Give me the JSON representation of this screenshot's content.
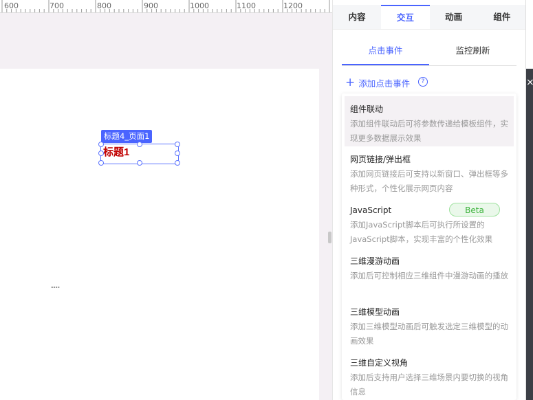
{
  "ruler": {
    "labels": [
      "600",
      "700",
      "800",
      "900",
      "1000",
      "1100",
      "1200"
    ]
  },
  "canvas": {
    "component_tag": "标题4_页面1",
    "component_text": "标题1",
    "mini_text": "\"\"\"\""
  },
  "panel": {
    "tabs": [
      {
        "label": "内容",
        "active": false
      },
      {
        "label": "交互",
        "active": true
      },
      {
        "label": "动画",
        "active": false
      },
      {
        "label": "组件",
        "active": false
      }
    ],
    "subtabs": [
      {
        "label": "点击事件",
        "active": true
      },
      {
        "label": "监控刷新",
        "active": false
      }
    ],
    "add_label": "添加点击事件",
    "help_glyph": "?",
    "options": [
      {
        "title": "组件联动",
        "desc": "添加组件联动后可将参数传递给模板组件，实现更多数据展示效果",
        "badge": ""
      },
      {
        "title": "网页链接/弹出框",
        "desc": "添加网页链接后可支持以新窗口、弹出框等多种形式，个性化展示网页内容",
        "badge": ""
      },
      {
        "title": "JavaScript",
        "desc": "添加JavaScript脚本后可执行所设置的JavaScript脚本，实现丰富的个性化效果",
        "badge": "Beta"
      },
      {
        "title": "三维漫游动画",
        "desc": "添加后可控制相应三维组件中漫游动画的播放",
        "badge": ""
      },
      {
        "title": "三维模型动画",
        "desc": "添加三维模型动画后可触发选定三维模型的动画效果",
        "badge": ""
      },
      {
        "title": "三维自定义视角",
        "desc": "添加后支持用户选择三维场景内要切换的视角信息",
        "badge": ""
      }
    ]
  },
  "strip": {
    "close_glyph": "×"
  },
  "colors": {
    "accent": "#4a64ff",
    "title_red": "#c00000",
    "beta_green": "#3bb23b"
  }
}
